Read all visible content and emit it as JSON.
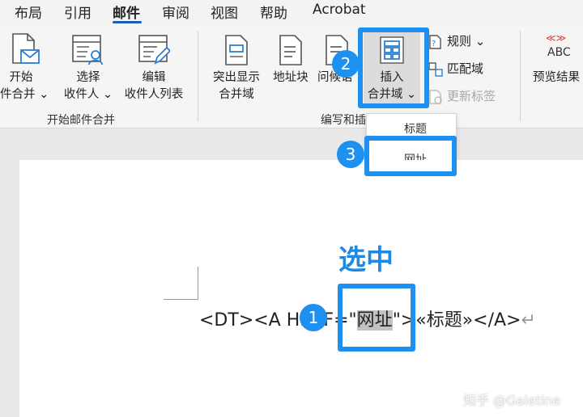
{
  "tabs": [
    "布局",
    "引用",
    "邮件",
    "审阅",
    "视图",
    "帮助",
    "Acrobat"
  ],
  "ribbon": {
    "start_merge": {
      "line1": "开始",
      "line2": "件合并 ⌄"
    },
    "select_recipients": {
      "line1": "选择",
      "line2": "收件人 ⌄"
    },
    "edit_list": {
      "line1": "编辑",
      "line2": "收件人列表"
    },
    "group_start_label": "开始邮件合并",
    "highlight_fields": {
      "line1": "突出显示",
      "line2": "合并域"
    },
    "address_block": {
      "label": "地址块"
    },
    "greeting_line": {
      "label": "问候语"
    },
    "insert_field": {
      "line1": "插入",
      "line2": "合并域 ⌄"
    },
    "rules": {
      "label": "规则 ⌄"
    },
    "match_fields": {
      "label": "匹配域"
    },
    "update_labels": {
      "label": "更新标签"
    },
    "group_write_label": "编写和插入域",
    "preview": {
      "icon_text_top": "≪≫",
      "icon_text": "ABC",
      "label": "预览结果"
    }
  },
  "dropdown": {
    "items": [
      "标题",
      "网址"
    ]
  },
  "badges": {
    "one": "1",
    "two": "2",
    "three": "3"
  },
  "annotation": "选中",
  "document": {
    "before": "<DT><A HREF=\"",
    "selected": "网址",
    "after": "\">«标题»</A>",
    "para_mark": "↵"
  },
  "watermark": "知乎 @Galetine",
  "colors": {
    "accent": "#1e90f0",
    "tab_underline": "#1a5fb4",
    "selection": "#c2c2c2"
  }
}
